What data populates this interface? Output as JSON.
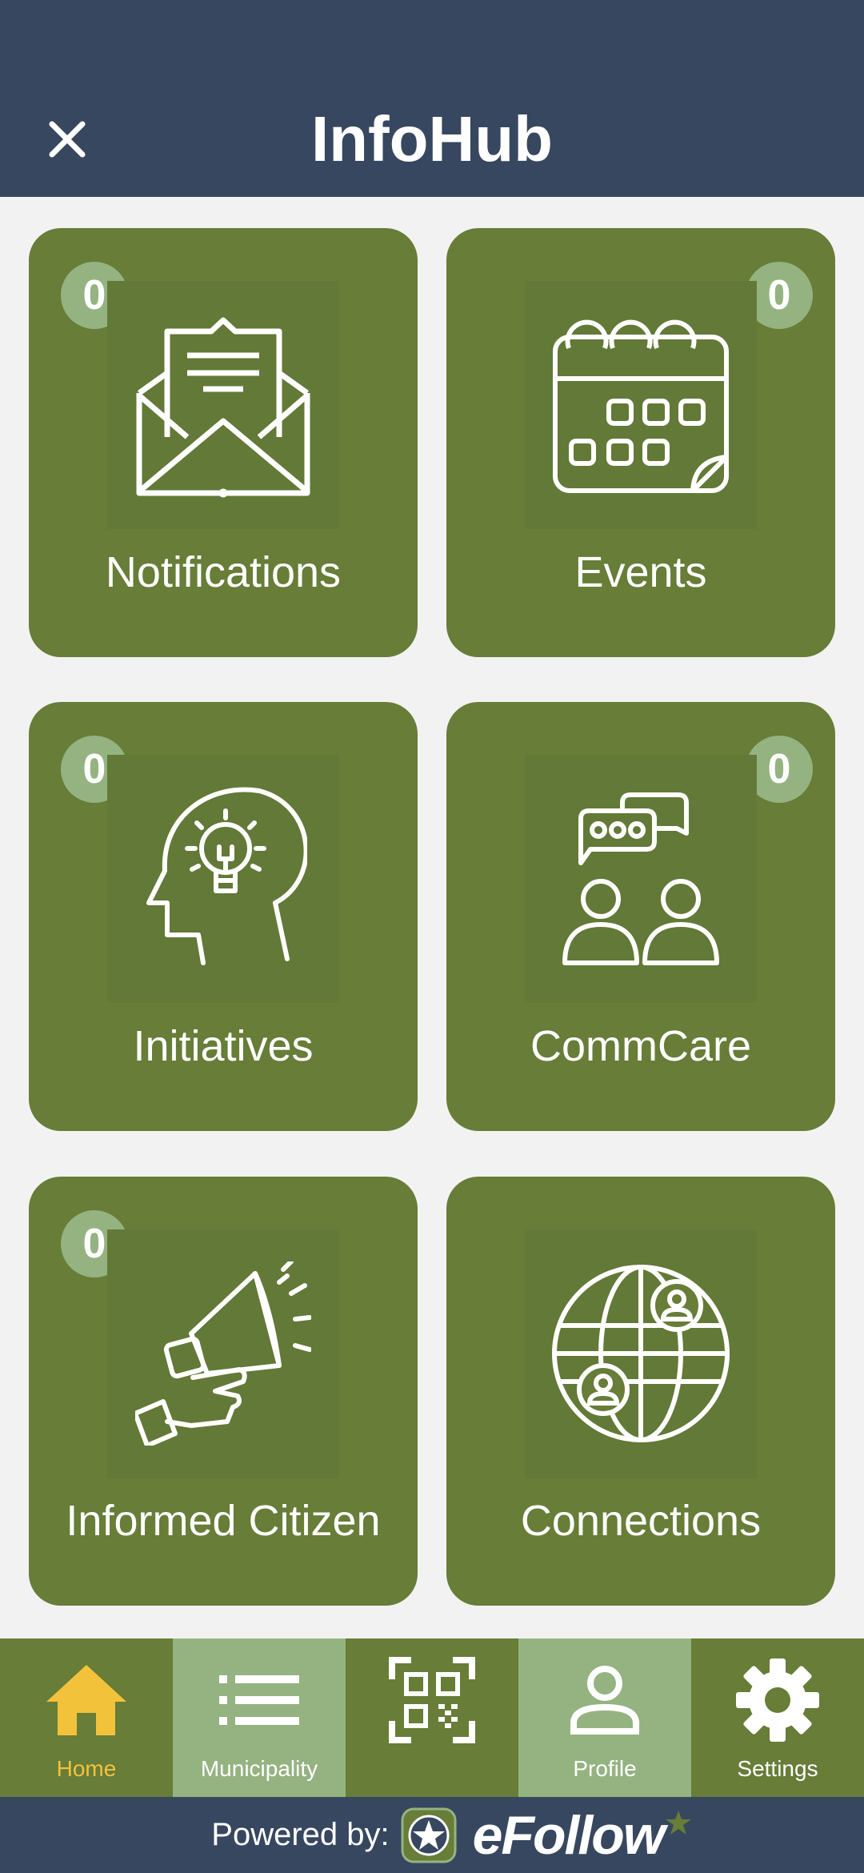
{
  "header": {
    "title": "InfoHub",
    "close_icon": "close-icon"
  },
  "tiles": [
    {
      "label": "Notifications",
      "badge": "0",
      "icon": "envelope-icon"
    },
    {
      "label": "Events",
      "badge": "0",
      "icon": "calendar-icon"
    },
    {
      "label": "Initiatives",
      "badge": "0",
      "icon": "idea-head-icon"
    },
    {
      "label": "CommCare",
      "badge": "0",
      "icon": "people-chat-icon"
    },
    {
      "label": "Informed Citizen",
      "badge": "0",
      "icon": "megaphone-icon"
    },
    {
      "label": "Connections",
      "icon": "globe-people-icon"
    }
  ],
  "nav": {
    "items": [
      {
        "label": "Home",
        "icon": "home-icon",
        "active": false
      },
      {
        "label": "Municipality",
        "icon": "list-icon",
        "active": true
      },
      {
        "label": "",
        "icon": "qr-code-icon",
        "active": false
      },
      {
        "label": "Profile",
        "icon": "user-icon",
        "active": true
      },
      {
        "label": "Settings",
        "icon": "gear-icon",
        "active": false
      }
    ]
  },
  "footer": {
    "powered_by": "Powered by:",
    "brand": "eFollow"
  },
  "colors": {
    "header_bg": "#37475f",
    "tile_bg": "#677d38",
    "badge_bg": "#94b381",
    "home_accent": "#f3c23b",
    "page_bg": "#f2f2f2"
  }
}
